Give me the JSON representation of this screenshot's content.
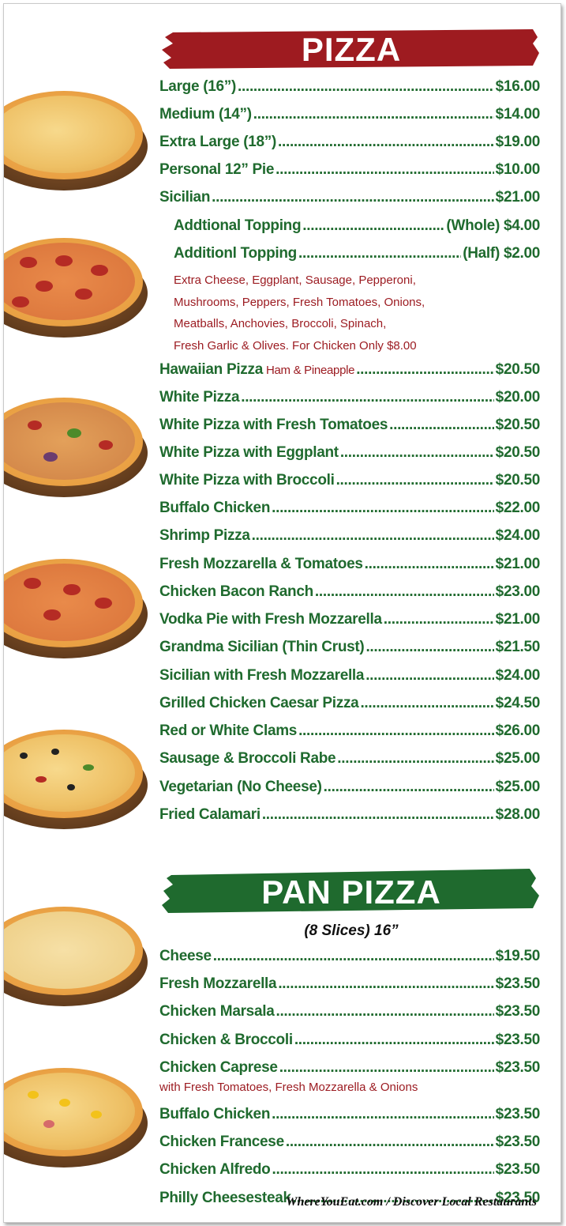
{
  "pizza_section": {
    "title": "PIZZA",
    "items": [
      {
        "name": "Large (16”)",
        "price": "$16.00"
      },
      {
        "name": "Medium (14”)",
        "price": "$14.00"
      },
      {
        "name": "Extra Large (18”)",
        "price": "$19.00"
      },
      {
        "name": "Personal 12” Pie",
        "price": "$10.00"
      },
      {
        "name": "Sicilian",
        "price": "$21.00"
      }
    ],
    "toppings": [
      {
        "name": "Addtional Topping",
        "price": "(Whole) $4.00"
      },
      {
        "name": "Additionl Topping",
        "price": "(Half) $2.00"
      }
    ],
    "topping_desc": [
      "Extra Cheese, Eggplant, Sausage, Pepperoni,",
      "Mushrooms, Peppers, Fresh Tomatoes, Onions,",
      "Meatballs, Anchovies, Broccoli, Spinach,",
      "Fresh Garlic & Olives. For Chicken Only $8.00"
    ],
    "specialties": [
      {
        "name": "Hawaiian Pizza",
        "note": "Ham & Pineapple",
        "price": "$20.50"
      },
      {
        "name": "White Pizza",
        "note": "",
        "price": "$20.00"
      },
      {
        "name": "White Pizza with Fresh Tomatoes",
        "note": "",
        "price": "$20.50"
      },
      {
        "name": "White Pizza with Eggplant",
        "note": "",
        "price": "$20.50"
      },
      {
        "name": "White Pizza with Broccoli",
        "note": "",
        "price": "$20.50"
      },
      {
        "name": "Buffalo Chicken",
        "note": "",
        "price": "$22.00"
      },
      {
        "name": "Shrimp Pizza",
        "note": "",
        "price": "$24.00"
      },
      {
        "name": "Fresh Mozzarella & Tomatoes",
        "note": "",
        "price": "$21.00"
      },
      {
        "name": "Chicken Bacon Ranch",
        "note": "",
        "price": "$23.00"
      },
      {
        "name": "Vodka Pie with Fresh Mozzarella",
        "note": "",
        "price": "$21.00"
      },
      {
        "name": "Grandma Sicilian (Thin Crust)",
        "note": "",
        "price": "$21.50"
      },
      {
        "name": "Sicilian with Fresh Mozzarella",
        "note": "",
        "price": "$24.00"
      },
      {
        "name": "Grilled Chicken Caesar Pizza",
        "note": "",
        "price": "$24.50"
      },
      {
        "name": "Red or White Clams",
        "note": "",
        "price": "$26.00"
      },
      {
        "name": "Sausage & Broccoli Rabe",
        "note": "",
        "price": "$25.00"
      },
      {
        "name": "Vegetarian (No Cheese)",
        "note": "",
        "price": "$25.00"
      },
      {
        "name": "Fried Calamari",
        "note": "",
        "price": "$28.00"
      }
    ]
  },
  "pan_section": {
    "title": "PAN PIZZA",
    "subtitle": "(8 Slices) 16”",
    "items": [
      {
        "name": "Cheese",
        "price": "$19.50"
      },
      {
        "name": "Fresh Mozzarella",
        "price": "$23.50"
      },
      {
        "name": "Chicken Marsala",
        "price": "$23.50"
      },
      {
        "name": "Chicken & Broccoli",
        "price": "$23.50"
      },
      {
        "name": "Chicken Caprese",
        "price": "$23.50"
      }
    ],
    "caprese_desc": "with Fresh Tomatoes, Fresh Mozzarella & Onions",
    "items2": [
      {
        "name": "Buffalo Chicken",
        "price": "$23.50"
      },
      {
        "name": "Chicken Francese",
        "price": "$23.50"
      },
      {
        "name": "Chicken Alfredo",
        "price": "$23.50"
      },
      {
        "name": "Philly Cheesesteak",
        "price": "$23.50"
      }
    ]
  },
  "footer": {
    "watermark": "WhereYouEat.com / Discover Local Restaurants"
  },
  "colors": {
    "green": "#1f6a2e",
    "red": "#9c1c22",
    "banner_red": "#9e1b20",
    "banner_green": "#1f6a2e"
  },
  "icons": [
    "pizza-image"
  ]
}
